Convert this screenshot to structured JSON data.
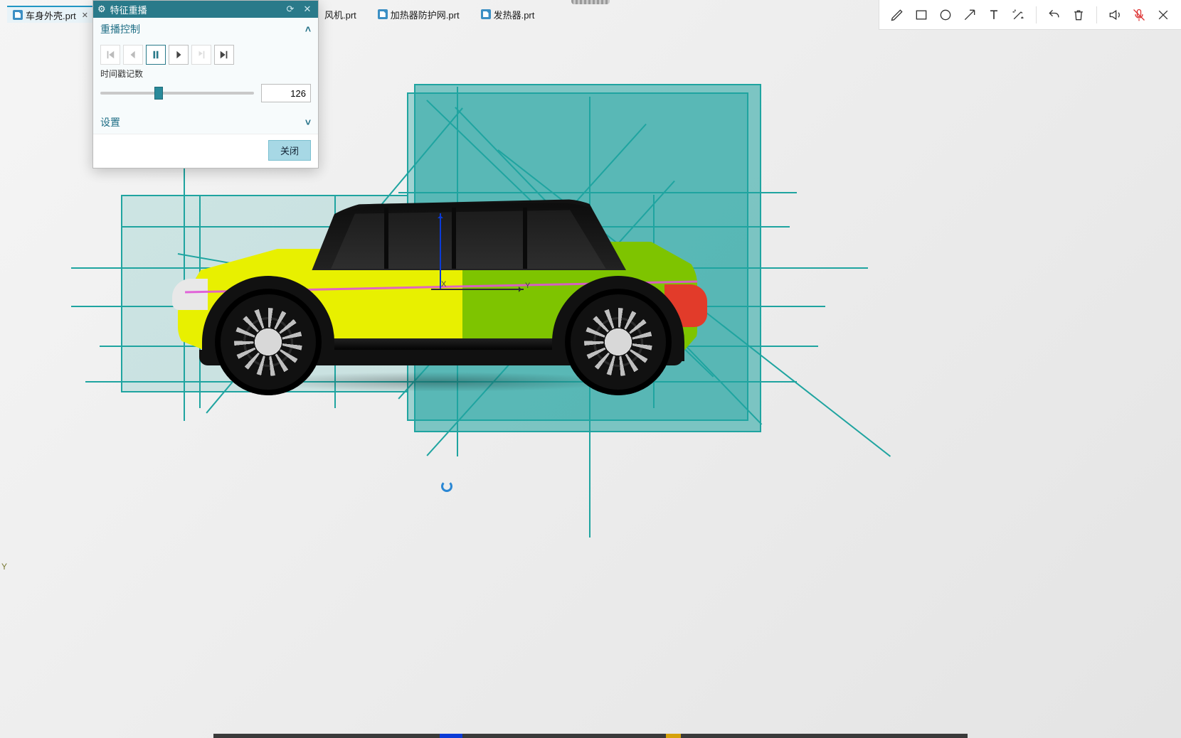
{
  "tabs": {
    "active": {
      "label": "车身外壳.prt"
    },
    "truncated": {
      "label": "风机.prt"
    },
    "t3": {
      "label": "加热器防护网.prt"
    },
    "t4": {
      "label": "发热器.prt"
    }
  },
  "toolbar_icons": {
    "pencil": "pencil-icon",
    "rect": "rectangle-icon",
    "circle": "circle-icon",
    "arrow": "arrow-icon",
    "text": "text-icon",
    "wand": "magic-wand-icon",
    "undo": "undo-icon",
    "delete": "trash-icon",
    "speaker": "speaker-icon",
    "mic": "mic-off-icon",
    "close": "close-icon"
  },
  "dialog": {
    "title": "特征重播",
    "section_controls": "重播控制",
    "section_settings": "设置",
    "timestamp_label": "时间戳记数",
    "timestamp_value": "126",
    "close_label": "关闭",
    "play_buttons": {
      "first": "skip-to-start",
      "prev": "step-back",
      "pause": "pause",
      "next": "step-forward",
      "flag": "flag-frame",
      "last": "skip-to-end"
    }
  },
  "gizmo": {
    "x": "X",
    "y": "Y"
  },
  "axis_corner": "Y"
}
